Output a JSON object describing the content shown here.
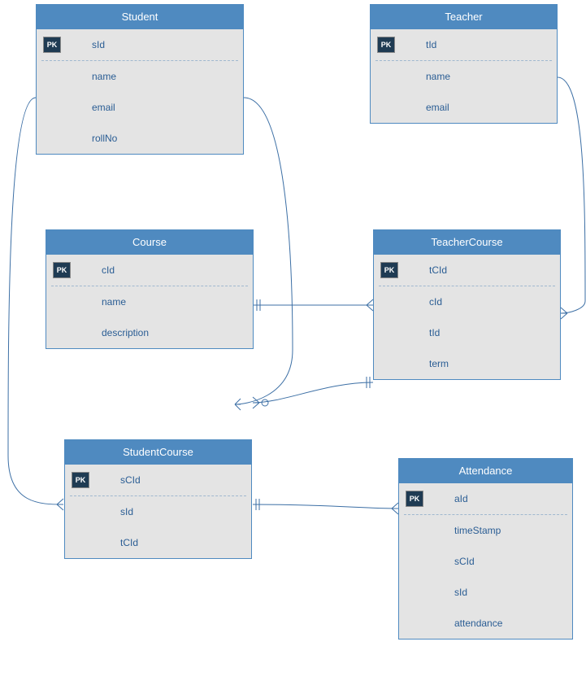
{
  "entities": {
    "student": {
      "title": "Student",
      "pk": "PK",
      "attrs": [
        "sId",
        "name",
        "email",
        "rollNo"
      ]
    },
    "teacher": {
      "title": "Teacher",
      "pk": "PK",
      "attrs": [
        "tId",
        "name",
        "email"
      ]
    },
    "course": {
      "title": "Course",
      "pk": "PK",
      "attrs": [
        "cId",
        "name",
        "description"
      ]
    },
    "teacherCourse": {
      "title": "TeacherCourse",
      "pk": "PK",
      "attrs": [
        "tCId",
        "cId",
        "tId",
        "term"
      ]
    },
    "studentCourse": {
      "title": "StudentCourse",
      "pk": "PK",
      "attrs": [
        "sCId",
        "sId",
        "tCId"
      ]
    },
    "attendance": {
      "title": "Attendance",
      "pk": "PK",
      "attrs": [
        "aId",
        "timeStamp",
        "sCId",
        "sId",
        "attendance"
      ]
    }
  },
  "colors": {
    "header": "#4f8ac0",
    "body": "#e4e4e4",
    "pkBadge": "#1f3b53",
    "text": "#2a5d94",
    "line": "#3c6fa5"
  }
}
